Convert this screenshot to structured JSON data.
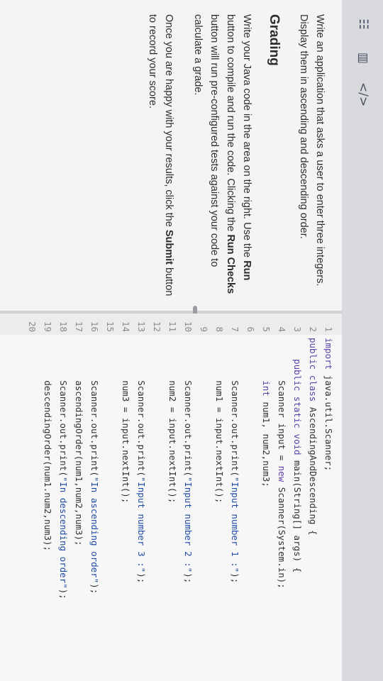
{
  "sidebar": {
    "icons": [
      "list-icon",
      "chart-icon",
      "code-icon"
    ],
    "code_symbol": "</>"
  },
  "instructions": {
    "paragraph1": "Write an application that asks a user to enter three integers. Display them in ascending and descending order.",
    "heading": "Grading",
    "p2_a": "Write your Java code in the area on the right. Use the ",
    "p2_run": "Run",
    "p2_b": " button to compile and run the code. Clicking the ",
    "p2_checks": "Run Checks",
    "p2_c": " button will run pre-configured tests against your code to calculate a grade.",
    "p3_a": "Once you are happy with your results, click the ",
    "p3_submit": "Submit",
    "p3_b": " button to record your score."
  },
  "editor": {
    "lines": [
      {
        "n": "1",
        "code": "import java.util.Scanner;"
      },
      {
        "n": "2",
        "code": "public class AscendingAndDescending {"
      },
      {
        "n": "3",
        "code": "    public static void main(String[] args) {"
      },
      {
        "n": "4",
        "code": "        Scanner input = new Scanner(System.in);"
      },
      {
        "n": "5",
        "code": "        int num1, num2,num3;"
      },
      {
        "n": "6",
        "code": ""
      },
      {
        "n": "7",
        "code": "        Scanner.out.print(\"Input number 1 :\");"
      },
      {
        "n": "8",
        "code": "        num1 = input.nextInt();"
      },
      {
        "n": "9",
        "code": ""
      },
      {
        "n": "10",
        "code": "        Scanner.out.print(\"Input number 2 :\");"
      },
      {
        "n": "11",
        "code": "        num2 = input.nextInt();"
      },
      {
        "n": "12",
        "code": ""
      },
      {
        "n": "13",
        "code": "        Scanner.out.print(\"Input number 3 :\");"
      },
      {
        "n": "14",
        "code": "        num3 = input.nextInt();"
      },
      {
        "n": "15",
        "code": ""
      },
      {
        "n": "16",
        "code": "        Scanner.out.print(\"In ascending order\");"
      },
      {
        "n": "17",
        "code": "        ascendingOrder(num1,num2,num3);"
      },
      {
        "n": "18",
        "code": "        Scanner.out.print(\"In descending order\");"
      },
      {
        "n": "19",
        "code": "        descendingOrder(num1.num2,num3);"
      },
      {
        "n": "20",
        "code": ""
      }
    ]
  }
}
